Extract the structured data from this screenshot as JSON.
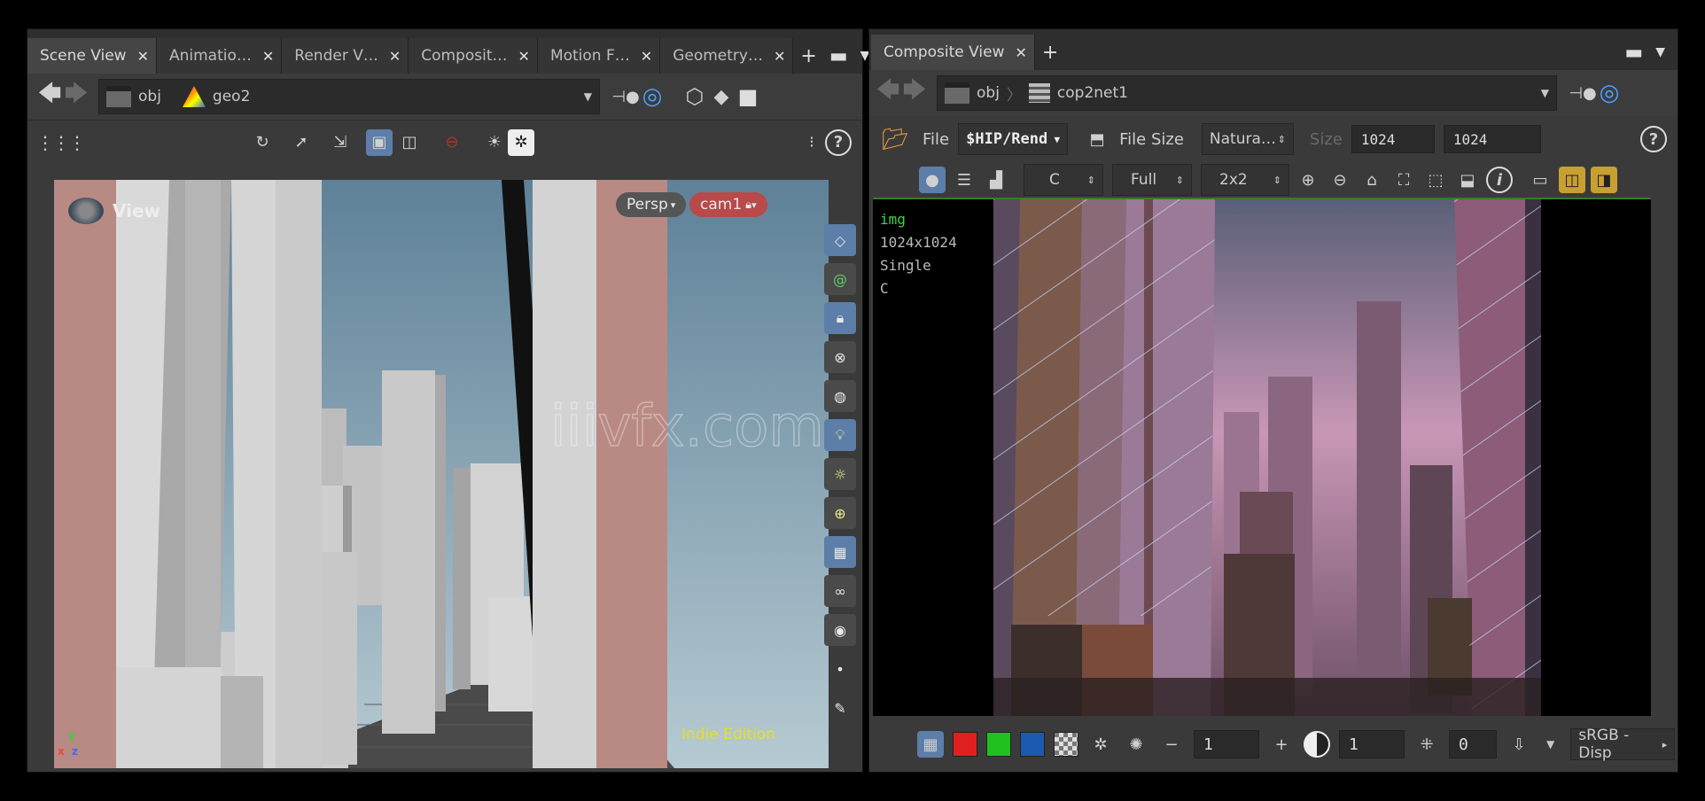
{
  "left_pane": {
    "tabs": [
      {
        "label": "Scene View",
        "active": true
      },
      {
        "label": "Animatio…",
        "active": false
      },
      {
        "label": "Render V…",
        "active": false
      },
      {
        "label": "Composit…",
        "active": false
      },
      {
        "label": "Motion F…",
        "active": false
      },
      {
        "label": "Geometry…",
        "active": false
      }
    ],
    "path": {
      "network": "obj",
      "node": "geo2"
    },
    "viewport": {
      "title": "View",
      "projection": "Persp",
      "camera": "cam1",
      "edition_label": "Indie Edition",
      "edition_color": "#e8e020",
      "watermark": "iiivfx.com",
      "axes": {
        "x": "x",
        "y": "y",
        "z": "z"
      }
    }
  },
  "right_pane": {
    "tabs": [
      {
        "label": "Composite View",
        "active": true
      }
    ],
    "path": {
      "network": "obj",
      "node": "cop2net1"
    },
    "file_row": {
      "file_label": "File",
      "file_value": "$HIP/Rend",
      "file_size_label": "File Size",
      "file_size_value": "Natura…",
      "size_label": "Size",
      "size_w": "1024",
      "size_h": "1024"
    },
    "view_row": {
      "channel": "C",
      "resolution": "Full",
      "grid": "2x2"
    },
    "image_info": {
      "name": "img",
      "dimensions": "1024x1024",
      "precision": "Single",
      "plane": "C",
      "name_color": "#3fd53f"
    },
    "bottom_bar": {
      "exposure_value": "1",
      "gamma_value": "1",
      "offset_value": "0",
      "lut": "sRGB - Disp"
    }
  }
}
